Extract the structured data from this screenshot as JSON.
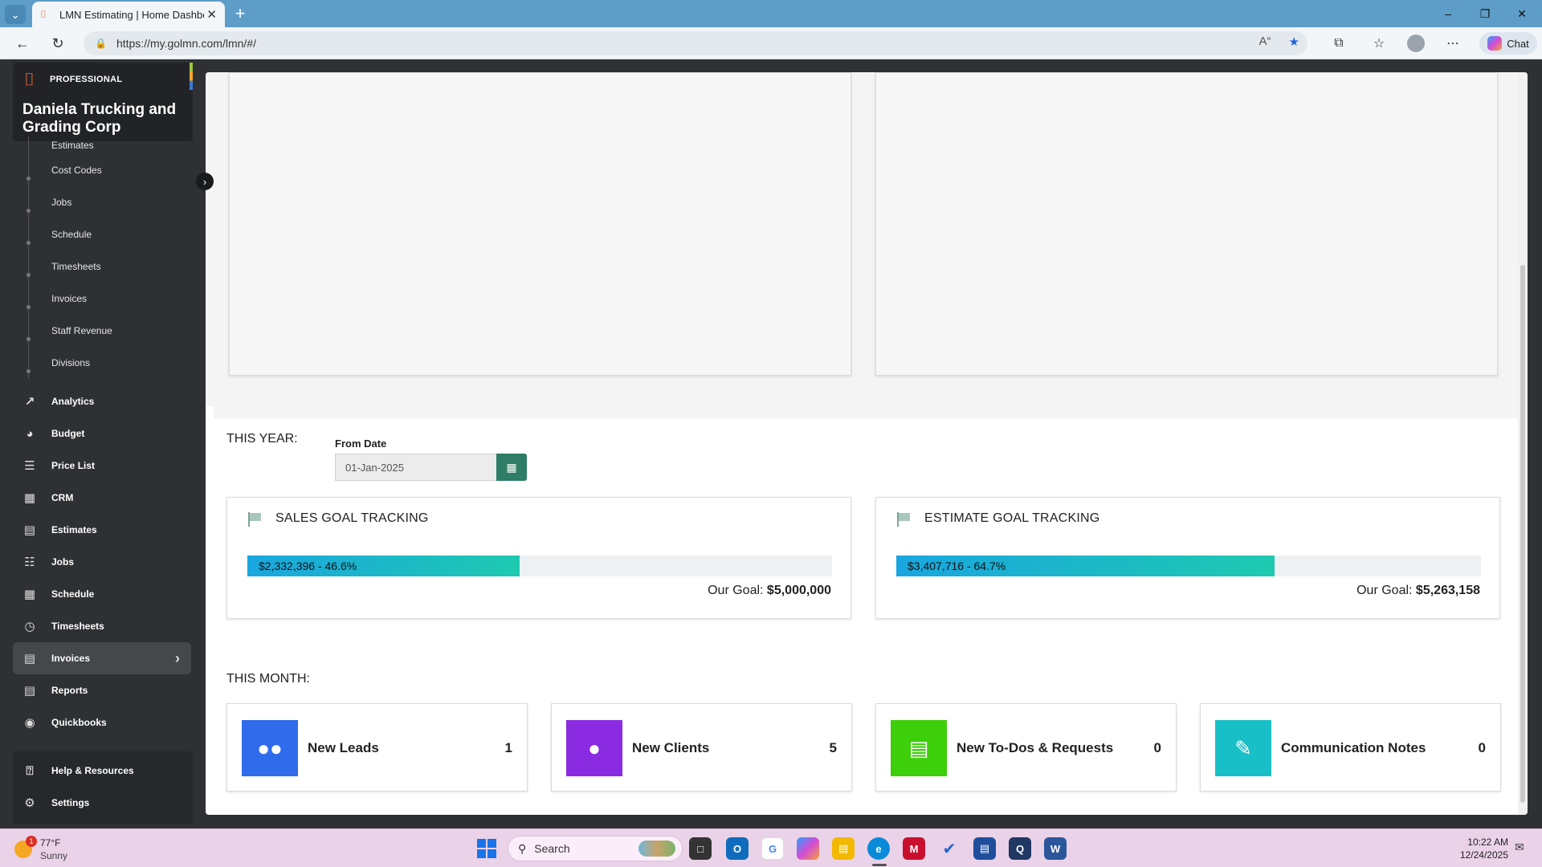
{
  "browser": {
    "tab_title": "LMN Estimating | Home Dashboard",
    "url": "https://my.golmn.com/lmn/#/",
    "chat_label": "Chat"
  },
  "brand": {
    "tier": "PROFESSIONAL",
    "company": "Daniela Trucking and Grading Corp"
  },
  "sidebar": {
    "sub_items": [
      "Estimates",
      "Cost Codes",
      "Jobs",
      "Schedule",
      "Timesheets",
      "Invoices",
      "Staff Revenue",
      "Divisions"
    ],
    "items": [
      {
        "label": "Analytics",
        "icon": "analytics-icon"
      },
      {
        "label": "Budget",
        "icon": "budget-icon"
      },
      {
        "label": "Price List",
        "icon": "price-list-icon"
      },
      {
        "label": "CRM",
        "icon": "crm-icon"
      },
      {
        "label": "Estimates",
        "icon": "estimates-icon"
      },
      {
        "label": "Jobs",
        "icon": "jobs-icon"
      },
      {
        "label": "Schedule",
        "icon": "schedule-icon"
      },
      {
        "label": "Timesheets",
        "icon": "timesheets-icon"
      },
      {
        "label": "Invoices",
        "icon": "invoices-icon",
        "active": true
      },
      {
        "label": "Reports",
        "icon": "reports-icon"
      },
      {
        "label": "Quickbooks",
        "icon": "quickbooks-icon"
      }
    ],
    "help": {
      "label": "Help & Resources"
    },
    "settings": {
      "label": "Settings"
    }
  },
  "dashboard": {
    "this_year_label": "THIS YEAR:",
    "from_date_label": "From Date",
    "from_date_value": "01-Jan-2025",
    "sales": {
      "title": "SALES GOAL TRACKING",
      "bar_text": "$2,332,396 - 46.6%",
      "percent": 46.6,
      "goal_prefix": "Our Goal:",
      "goal_value": "$5,000,000"
    },
    "estimate": {
      "title": "ESTIMATE GOAL TRACKING",
      "bar_text": "$3,407,716 - 64.7%",
      "percent": 64.7,
      "goal_prefix": "Our Goal:",
      "goal_value": "$5,263,158"
    },
    "this_month_label": "THIS MONTH:",
    "stats": [
      {
        "label": "New Leads",
        "count": "1",
        "color": "#2f6bea",
        "icon": "users-icon"
      },
      {
        "label": "New Clients",
        "count": "5",
        "color": "#8a2be2",
        "icon": "user-icon"
      },
      {
        "label": "New To-Dos & Requests",
        "count": "0",
        "color": "#3ccf0a",
        "icon": "clipboard-icon"
      },
      {
        "label": "Communication Notes",
        "count": "0",
        "color": "#19bfc6",
        "icon": "edit-note-icon"
      }
    ]
  },
  "taskbar": {
    "weather_temp": "77°F",
    "weather_condition": "Sunny",
    "weather_badge": "1",
    "search_label": "Search",
    "time": "10:22 AM",
    "date": "12/24/2025"
  }
}
